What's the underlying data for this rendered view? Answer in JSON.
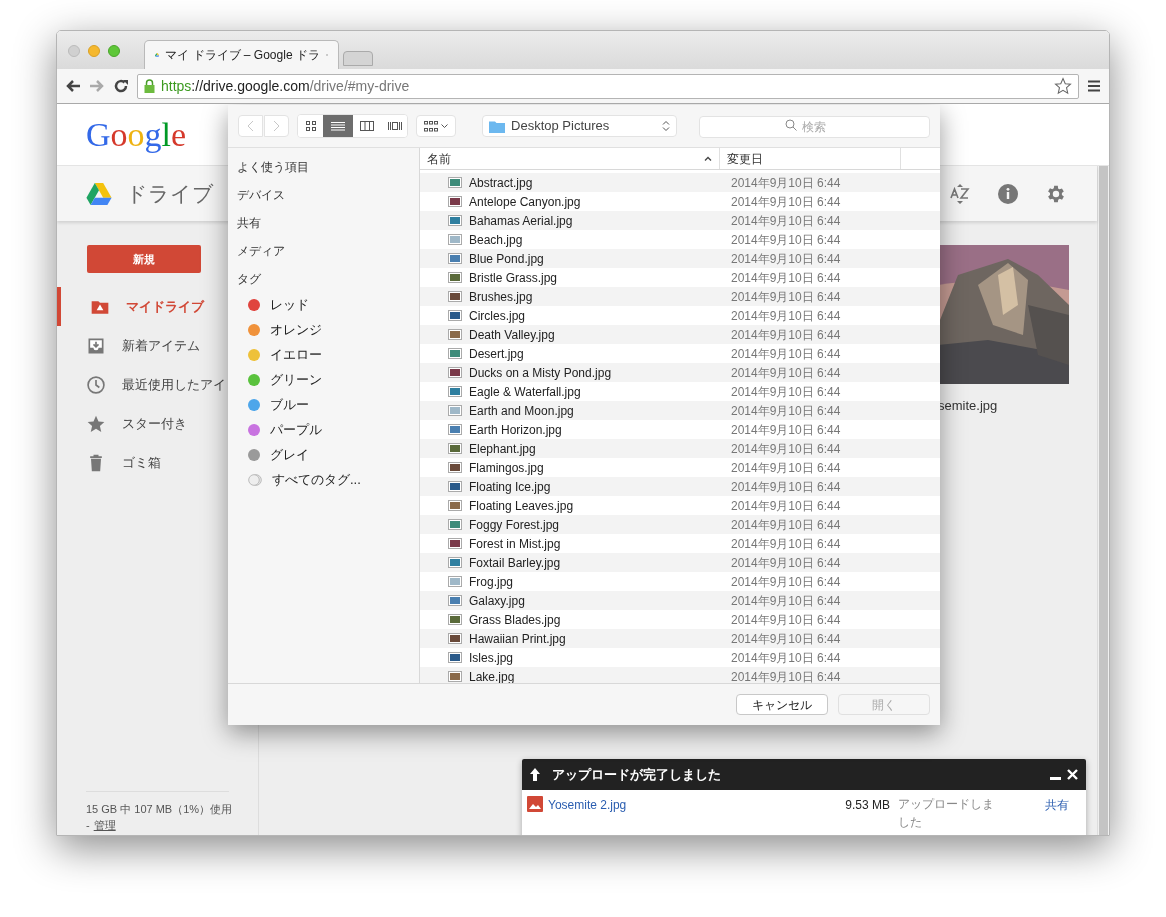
{
  "browser": {
    "tab": {
      "title": "マイ ドライブ – Google ドラ"
    },
    "url": {
      "scheme": "https",
      "host": "://drive.google.com",
      "path": "/drive/#my-drive"
    }
  },
  "drive": {
    "logo": "Google",
    "app_name": "ドライブ",
    "new_button": "新規",
    "nav": [
      {
        "label": "マイドライブ",
        "selected": true
      },
      {
        "label": "新着アイテム",
        "selected": false
      },
      {
        "label": "最近使用したアイ",
        "selected": false
      },
      {
        "label": "スター付き",
        "selected": false
      },
      {
        "label": "ゴミ箱",
        "selected": false
      }
    ],
    "storage": "15 GB 中 107 MB（1%）使用",
    "manage_prefix": "-",
    "manage_link": "管理",
    "file_tile": {
      "kind": "picture",
      "name": "semite.jpg"
    }
  },
  "dialog": {
    "view_modes": [
      {
        "kind": "icons",
        "selected": false
      },
      {
        "kind": "list",
        "selected": true
      },
      {
        "kind": "columns",
        "selected": false
      },
      {
        "kind": "coverflow",
        "selected": false
      }
    ],
    "location": "Desktop Pictures",
    "search": {
      "placeholder": "検索"
    },
    "sidebar_sections": [
      "よく使う項目",
      "デバイス",
      "共有",
      "メディア"
    ],
    "tags_heading": "タグ",
    "tags": [
      {
        "label": "レッド",
        "kind": "color",
        "color": "#e0443e"
      },
      {
        "label": "オレンジ",
        "kind": "color",
        "color": "#f0923b"
      },
      {
        "label": "イエロー",
        "kind": "color",
        "color": "#eec13a"
      },
      {
        "label": "グリーン",
        "kind": "color",
        "color": "#5ac23d"
      },
      {
        "label": "ブルー",
        "kind": "color",
        "color": "#4ea6ea"
      },
      {
        "label": "パープル",
        "kind": "color",
        "color": "#c873e0"
      },
      {
        "label": "グレイ",
        "kind": "color",
        "color": "#9a9a9a"
      },
      {
        "label": "すべてのタグ...",
        "kind": "all"
      }
    ],
    "columns": [
      {
        "label": "名前",
        "sorted": true
      },
      {
        "label": "変更日",
        "sorted": false
      }
    ],
    "rows": [
      {
        "name": "Abstract.jpg",
        "date": "2014年9月10日 6:44"
      },
      {
        "name": "Antelope Canyon.jpg",
        "date": "2014年9月10日 6:44"
      },
      {
        "name": "Bahamas Aerial.jpg",
        "date": "2014年9月10日 6:44"
      },
      {
        "name": "Beach.jpg",
        "date": "2014年9月10日 6:44"
      },
      {
        "name": "Blue Pond.jpg",
        "date": "2014年9月10日 6:44"
      },
      {
        "name": "Bristle Grass.jpg",
        "date": "2014年9月10日 6:44"
      },
      {
        "name": "Brushes.jpg",
        "date": "2014年9月10日 6:44"
      },
      {
        "name": "Circles.jpg",
        "date": "2014年9月10日 6:44"
      },
      {
        "name": "Death Valley.jpg",
        "date": "2014年9月10日 6:44"
      },
      {
        "name": "Desert.jpg",
        "date": "2014年9月10日 6:44"
      },
      {
        "name": "Ducks on a Misty Pond.jpg",
        "date": "2014年9月10日 6:44"
      },
      {
        "name": "Eagle & Waterfall.jpg",
        "date": "2014年9月10日 6:44"
      },
      {
        "name": "Earth and Moon.jpg",
        "date": "2014年9月10日 6:44"
      },
      {
        "name": "Earth Horizon.jpg",
        "date": "2014年9月10日 6:44"
      },
      {
        "name": "Elephant.jpg",
        "date": "2014年9月10日 6:44"
      },
      {
        "name": "Flamingos.jpg",
        "date": "2014年9月10日 6:44"
      },
      {
        "name": "Floating Ice.jpg",
        "date": "2014年9月10日 6:44"
      },
      {
        "name": "Floating Leaves.jpg",
        "date": "2014年9月10日 6:44"
      },
      {
        "name": "Foggy Forest.jpg",
        "date": "2014年9月10日 6:44"
      },
      {
        "name": "Forest in Mist.jpg",
        "date": "2014年9月10日 6:44"
      },
      {
        "name": "Foxtail Barley.jpg",
        "date": "2014年9月10日 6:44"
      },
      {
        "name": "Frog.jpg",
        "date": "2014年9月10日 6:44"
      },
      {
        "name": "Galaxy.jpg",
        "date": "2014年9月10日 6:44"
      },
      {
        "name": "Grass Blades.jpg",
        "date": "2014年9月10日 6:44"
      },
      {
        "name": "Hawaiian Print.jpg",
        "date": "2014年9月10日 6:44"
      },
      {
        "name": "Isles.jpg",
        "date": "2014年9月10日 6:44"
      },
      {
        "name": "Lake.jpg",
        "date": "2014年9月10日 6:44"
      }
    ],
    "buttons": [
      {
        "label": "キャンセル",
        "disabled": false
      },
      {
        "label": "開く",
        "disabled": true
      }
    ]
  },
  "upload": {
    "title": "アップロードが完了しました",
    "file": "Yosemite 2.jpg",
    "size": "9.53 MB",
    "status": "アップロードしました",
    "action": "共有"
  }
}
